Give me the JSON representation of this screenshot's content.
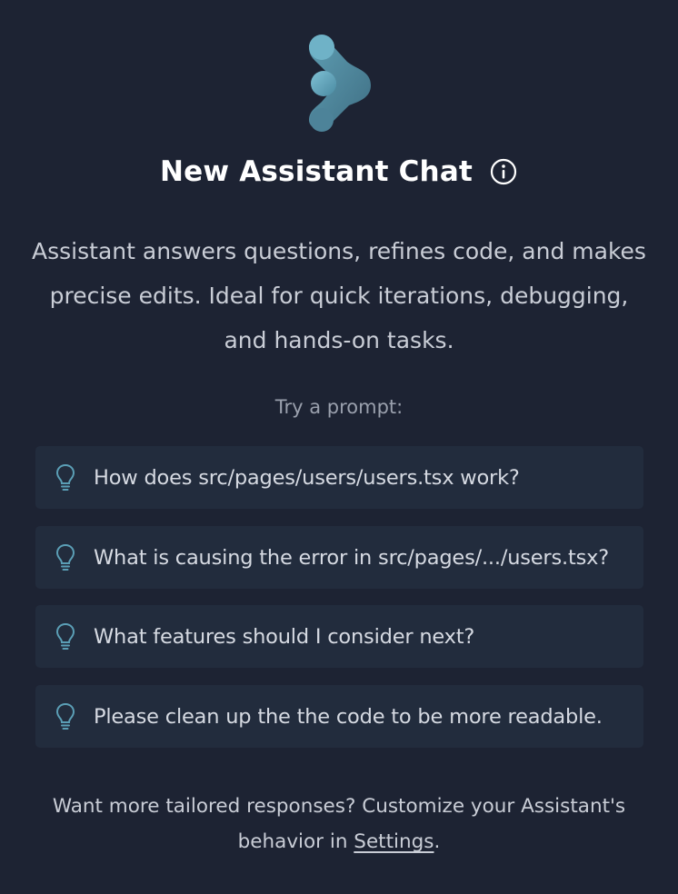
{
  "header": {
    "title": "New Assistant Chat",
    "logo_icon": "assistant-logo",
    "info_icon": "info-circle-icon"
  },
  "description": "Assistant answers questions, refines code, and makes precise edits. Ideal for quick iterations, debugging, and hands-on tasks.",
  "prompts": {
    "label": "Try a prompt:",
    "icon": "lightbulb-icon",
    "items": [
      {
        "text": "How does src/pages/users/users.tsx work?"
      },
      {
        "text": "What is causing the error in src/pages/.../users.tsx?"
      },
      {
        "text": "What features should I consider next?"
      },
      {
        "text": "Please clean up the the code to be more readable."
      }
    ]
  },
  "footer": {
    "text_before": "Want more tailored responses? Customize your Assistant's behavior in ",
    "link_label": "Settings",
    "text_after": "."
  },
  "colors": {
    "background": "#1d2333",
    "card": "#222c3d",
    "accent": "#5b9fb6"
  }
}
